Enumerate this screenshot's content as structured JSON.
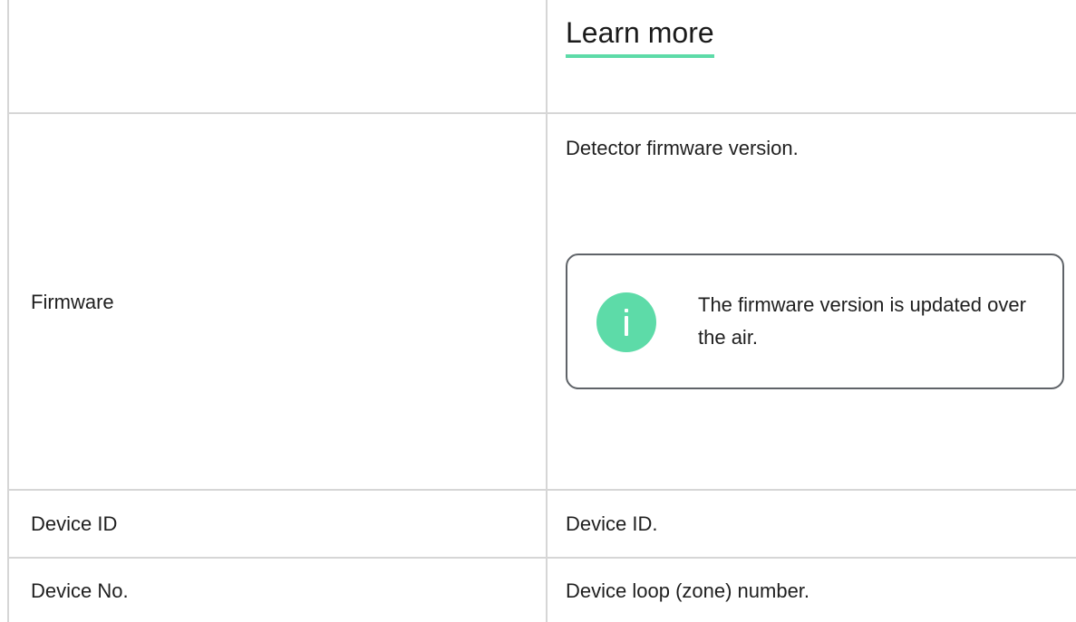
{
  "top_row": {
    "link_label": "Learn more"
  },
  "rows": [
    {
      "label": "Firmware",
      "description": "Detector firmware version.",
      "note": {
        "icon": "info-icon",
        "text": "The firmware version is updated over the air."
      }
    },
    {
      "label": "Device ID",
      "description": "Device ID."
    },
    {
      "label": "Device No.",
      "description": "Device loop (zone) number."
    }
  ],
  "colors": {
    "accent": "#5ddba8",
    "border": "#d6d6d6",
    "text": "#1f1f1f"
  }
}
